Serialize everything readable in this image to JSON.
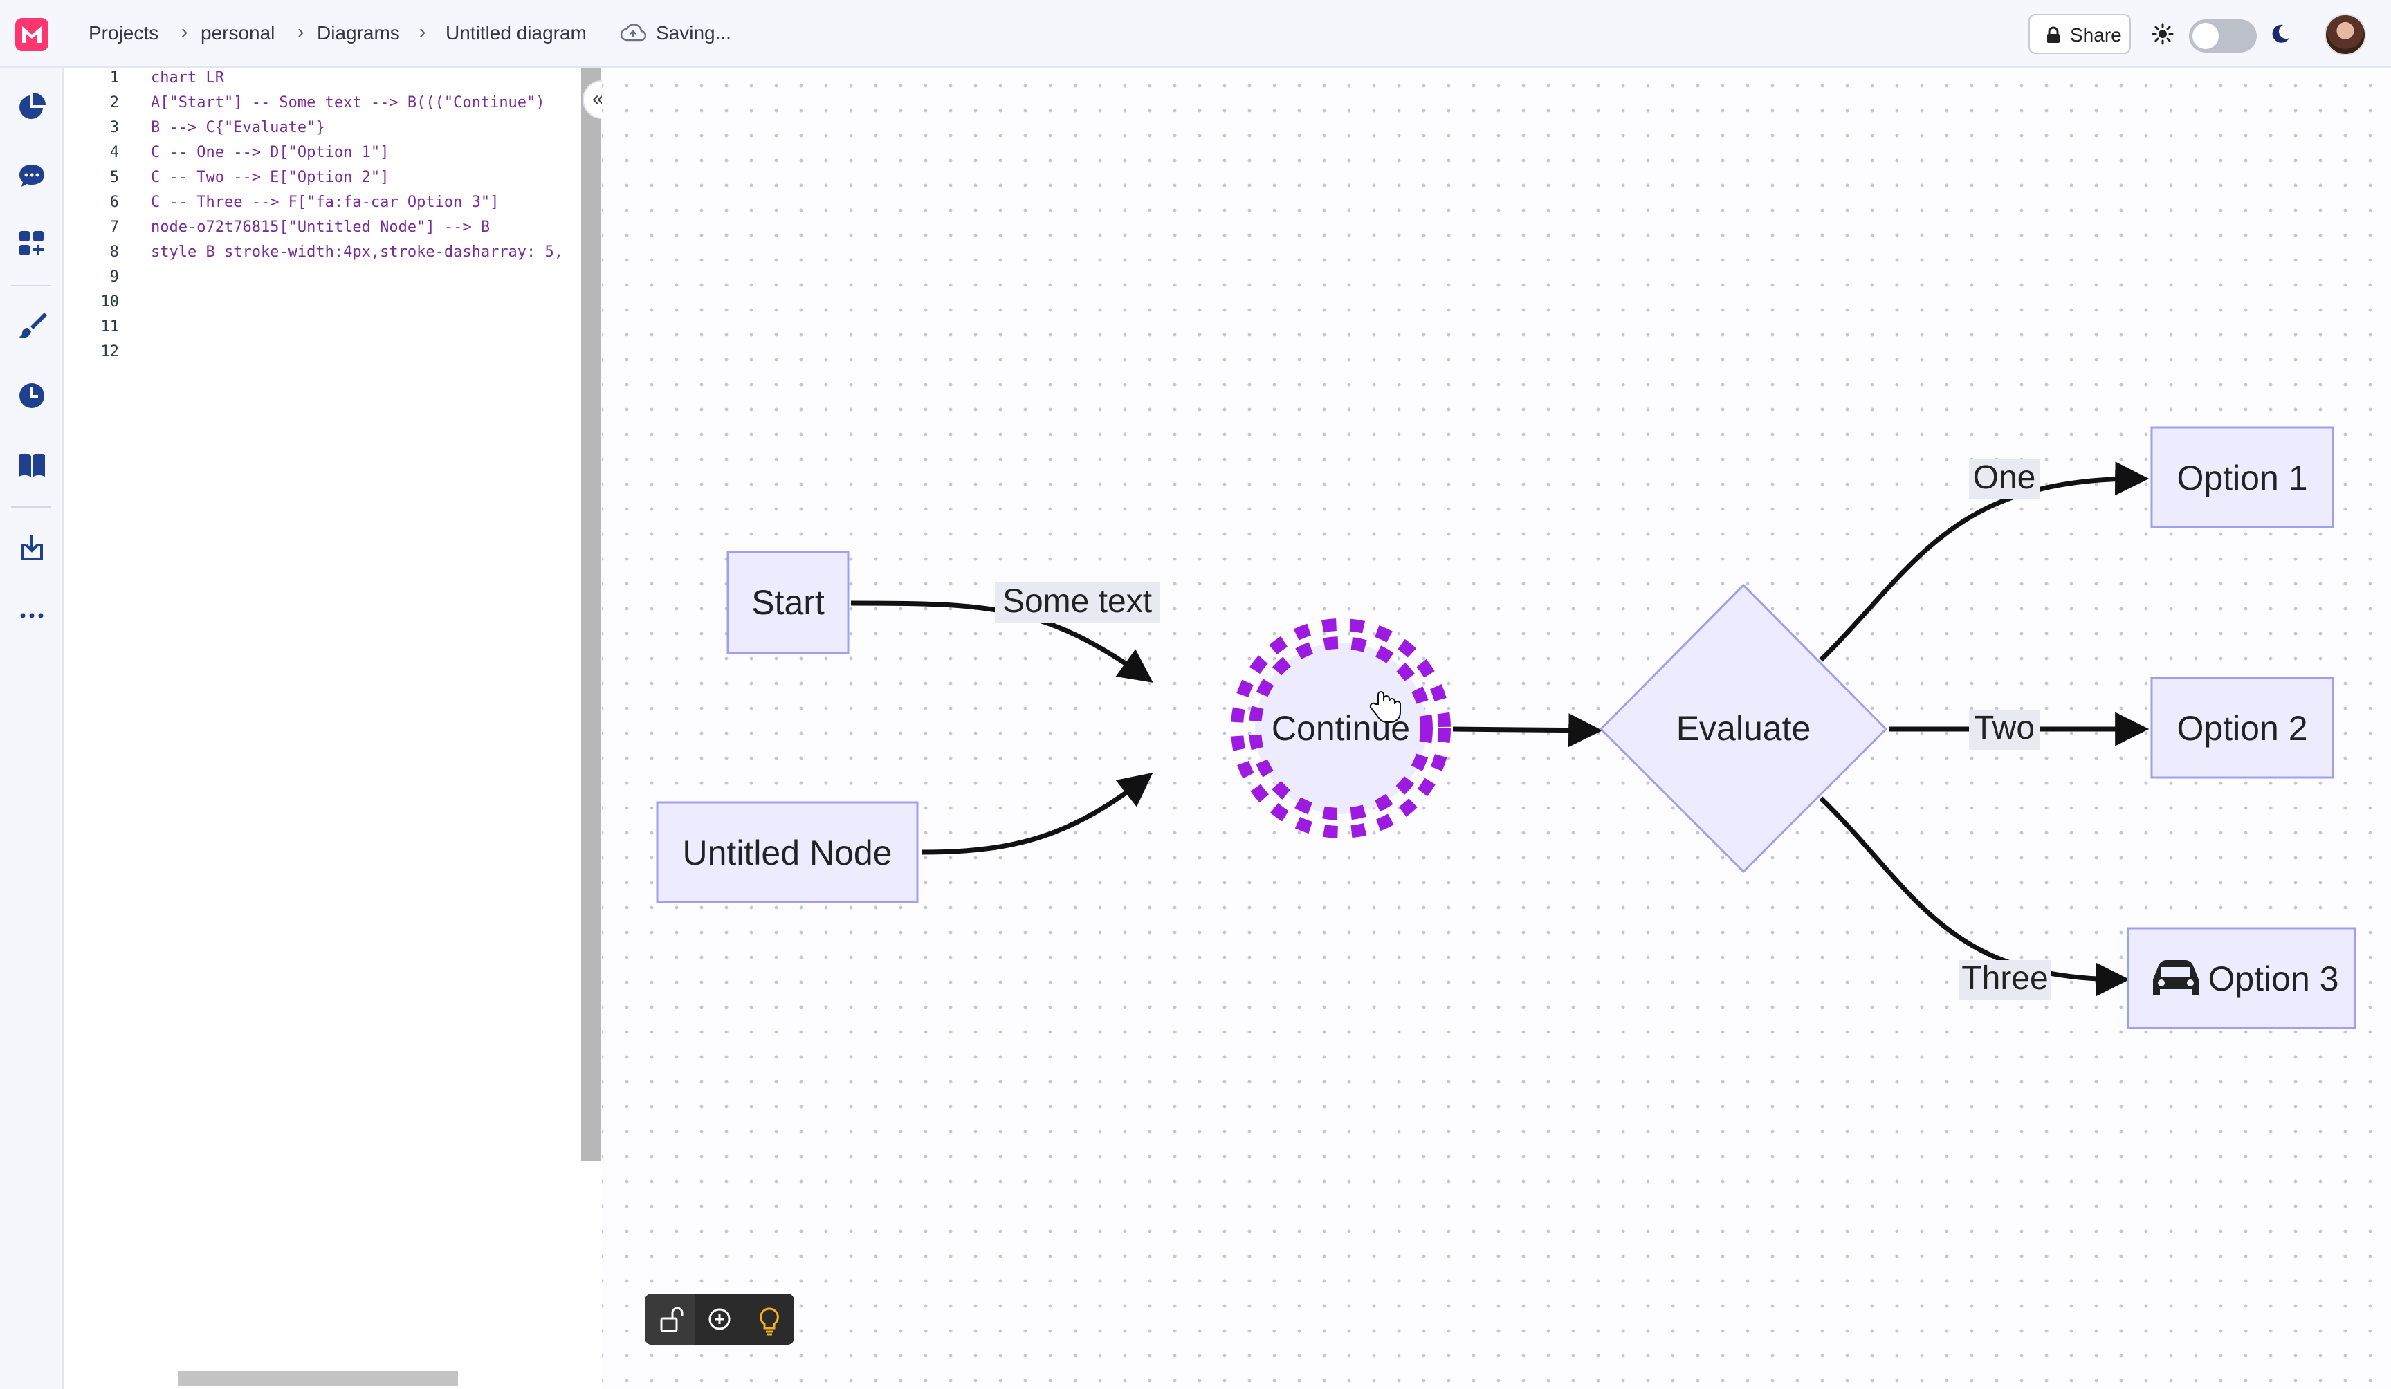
{
  "breadcrumb": {
    "projects": "Projects",
    "personal": "personal",
    "diagrams": "Diagrams",
    "diagram": "Untitled diagram",
    "separator": "›"
  },
  "status": {
    "saving": "Saving..."
  },
  "header": {
    "share_label": "Share"
  },
  "colors": {
    "brand": "#ff3670",
    "node_fill": "#ececfe",
    "node_stroke": "#9f9ff0",
    "continue_stroke": "#9d1be0",
    "edge": "#111111"
  },
  "rail": {
    "icons": [
      "pie-chart-icon",
      "chat-icon",
      "add-shapes-icon",
      "brush-icon",
      "history-icon",
      "book-icon",
      "import-icon",
      "more-icon"
    ]
  },
  "editor": {
    "line_numbers": [
      "1",
      "2",
      "3",
      "4",
      "5",
      "6",
      "7",
      "8",
      "9",
      "10",
      "11",
      "12"
    ],
    "lines": [
      "chart LR",
      "A[\"Start\"] -- Some text --> B(((\"Continue\")",
      "B --> C{\"Evaluate\"}",
      "C -- One --> D[\"Option 1\"]",
      "C -- Two --> E[\"Option 2\"]",
      "C -- Three --> F[\"fa:fa-car Option 3\"]",
      "node-o72t76815[\"Untitled Node\"] --> B",
      "style B stroke-width:4px,stroke-dasharray: 5,",
      "",
      "",
      "",
      ""
    ]
  },
  "diagram": {
    "nodes": {
      "start": "Start",
      "untitled": "Untitled Node",
      "continue": "Continue",
      "evaluate": "Evaluate",
      "option1": "Option 1",
      "option2": "Option 2",
      "option3": "Option 3"
    },
    "edges": {
      "some_text": "Some text",
      "one": "One",
      "two": "Two",
      "three": "Three"
    }
  },
  "canvas_toolbar": [
    "unlock-icon",
    "zoom-icon",
    "lightbulb-icon"
  ]
}
